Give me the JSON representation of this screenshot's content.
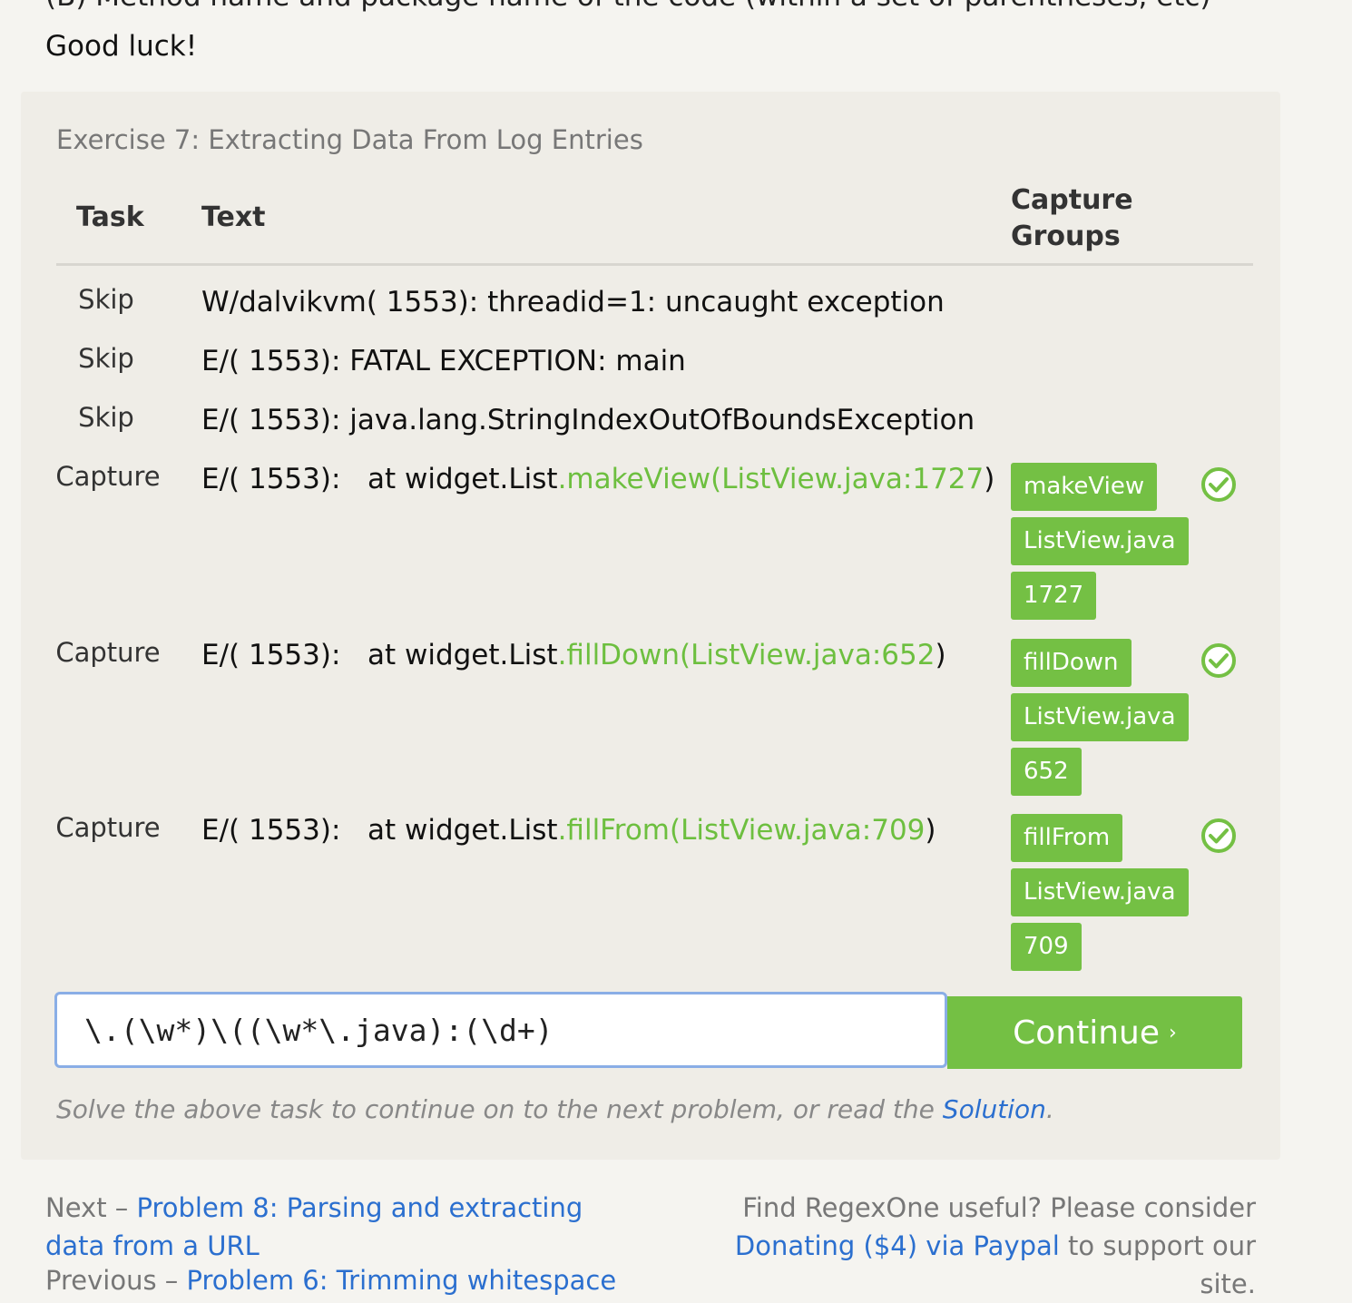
{
  "top_clip": "(B) Method name and package name of the code (within a set of parentheses, etc)",
  "good_luck": "Good luck!",
  "exercise": {
    "title": "Exercise 7: Extracting Data From Log Entries",
    "headers": {
      "task": "Task",
      "text": "Text",
      "groups_line1": "Capture",
      "groups_line2": "Groups"
    },
    "rows": [
      {
        "task": "Skip",
        "prefix": "W/dalvikvm( 1553): threadid=1: uncaught exception",
        "match": "",
        "suffix": "",
        "groups": []
      },
      {
        "task": "Skip",
        "prefix": "E/( 1553): FATAL EXCEPTION: main",
        "match": "",
        "suffix": "",
        "groups": []
      },
      {
        "task": "Skip",
        "prefix": "E/( 1553): java.lang.StringIndexOutOfBoundsException",
        "match": "",
        "suffix": "",
        "groups": []
      },
      {
        "task": "Capture",
        "prefix": "E/( 1553):   at widget.List",
        "match": ".makeView(ListView.java:1727",
        "suffix": ")",
        "groups": [
          "makeView",
          "ListView.java",
          "1727"
        ]
      },
      {
        "task": "Capture",
        "prefix": "E/( 1553):   at widget.List",
        "match": ".fillDown(ListView.java:652",
        "suffix": ")",
        "groups": [
          "fillDown",
          "ListView.java",
          "652"
        ]
      },
      {
        "task": "Capture",
        "prefix": "E/( 1553):   at widget.List",
        "match": ".fillFrom(ListView.java:709",
        "suffix": ")",
        "groups": [
          "fillFrom",
          "ListView.java",
          "709"
        ]
      }
    ],
    "status_icon": "check-circle-icon",
    "input_value": "\\.(\\w*)\\((\\w*\\.java):(\\d+)",
    "continue_label": "Continue",
    "continue_arrow": "›",
    "hint_text": "Solve the above task to continue on to the next problem, or read the ",
    "hint_link": "Solution",
    "hint_end": "."
  },
  "footer": {
    "next_prefix": "Next – ",
    "next_link": "Problem 8: Parsing and extracting data from a URL",
    "prev_prefix": "Previous – ",
    "prev_link": "Problem 6: Trimming whitespace",
    "donate_text": "Find RegexOne useful? Please consider",
    "donate_link": "Donating ($4) via Paypal",
    "donate_end": " to support our site."
  },
  "colors": {
    "accent_green": "#74c044",
    "match_green": "#6dbf3f",
    "link_blue": "#2b6fcf"
  }
}
